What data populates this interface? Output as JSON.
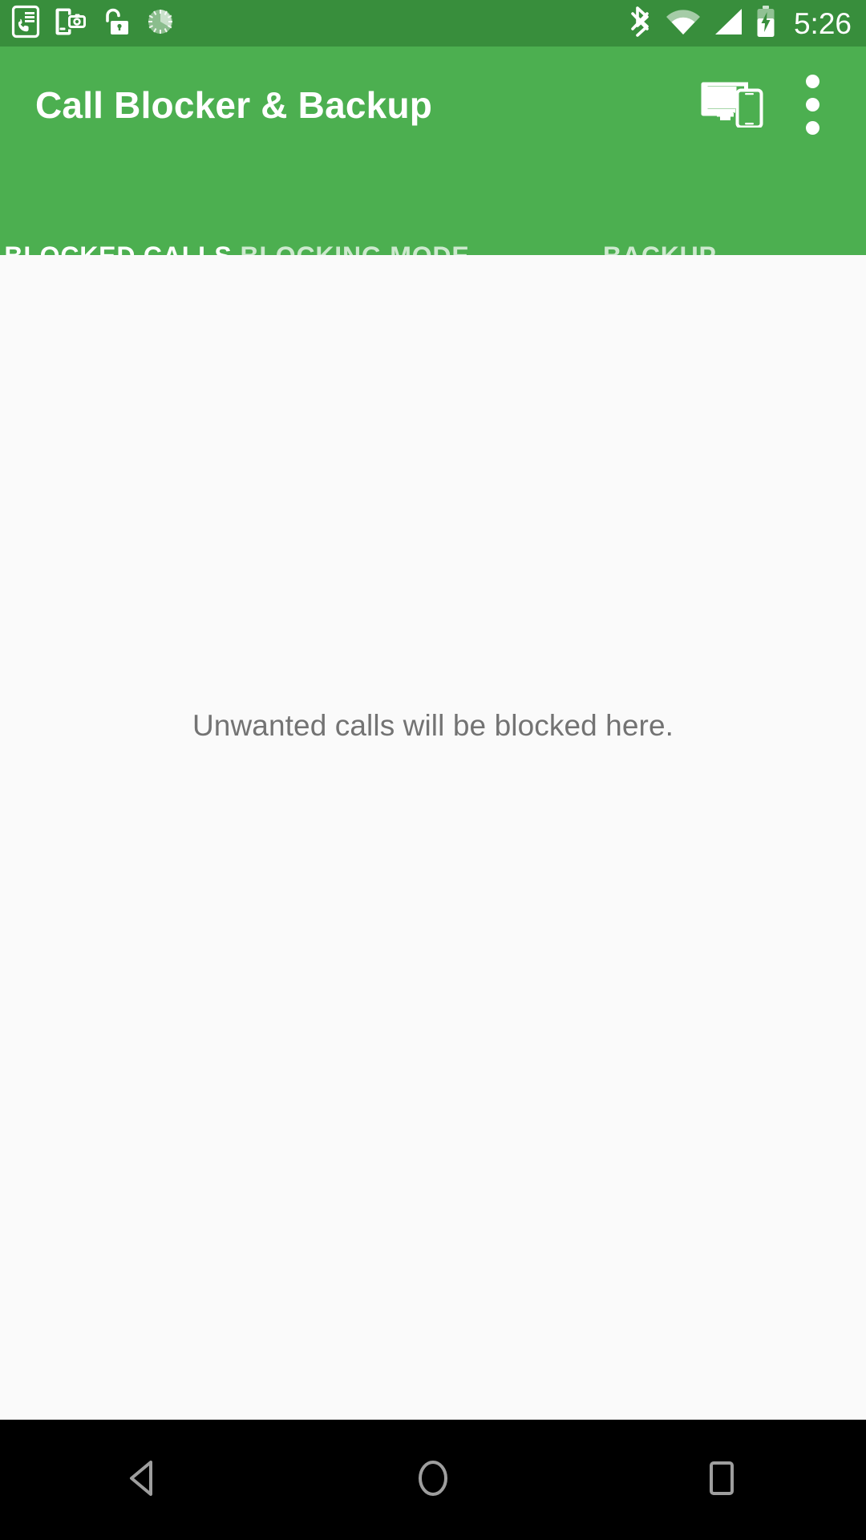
{
  "status_bar": {
    "background_color": "#388E3C",
    "clock": "5:26",
    "left_icons": [
      {
        "name": "call-log-icon",
        "label": "Call log notification"
      },
      {
        "name": "screenshot-icon",
        "label": "Screenshot captured"
      },
      {
        "name": "unlocked-padlock-icon",
        "label": "Device unlocked"
      },
      {
        "name": "sync-progress-icon",
        "label": "Sync in progress"
      }
    ],
    "right_icons": [
      {
        "name": "bluetooth-icon",
        "label": "Bluetooth on"
      },
      {
        "name": "wifi-icon",
        "label": "Wi-Fi connected"
      },
      {
        "name": "cellular-signal-icon",
        "label": "Cellular signal full"
      },
      {
        "name": "battery-charging-icon",
        "label": "Battery charging"
      }
    ]
  },
  "app_bar": {
    "background_color": "#4CAF50",
    "title": "Call Blocker & Backup",
    "actions": [
      {
        "name": "cast-devices-icon",
        "label": "Devices"
      },
      {
        "name": "overflow-menu-icon",
        "label": "More options"
      }
    ]
  },
  "tabs": {
    "indicator_color": "#E91E63",
    "selected_index": 0,
    "items": [
      {
        "label": "BLOCKED CALLS",
        "selected": true
      },
      {
        "label": "BLOCKING MODE",
        "selected": false
      },
      {
        "label": "BACKUP",
        "selected": false
      }
    ]
  },
  "content": {
    "background_color": "#FAFAFA",
    "empty_state_text": "Unwanted calls will be blocked here.",
    "empty_state_text_color": "#737373"
  },
  "navigation_bar": {
    "background_color": "#000000",
    "buttons": [
      {
        "name": "back-button",
        "label": "Back"
      },
      {
        "name": "home-button",
        "label": "Home"
      },
      {
        "name": "recents-button",
        "label": "Recent apps"
      }
    ]
  }
}
